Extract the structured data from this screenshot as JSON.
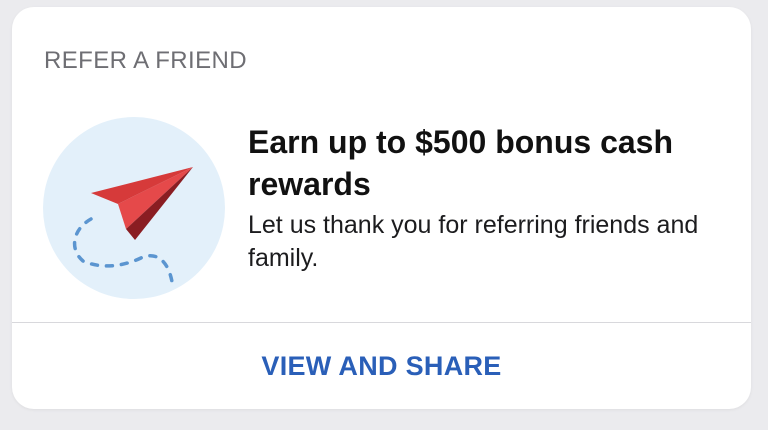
{
  "card": {
    "section_label": "REFER A FRIEND",
    "headline": "Earn up to $500 bonus cash rewards",
    "subtext": "Let us thank you for referring friends and family.",
    "action_label": "VIEW AND SHARE",
    "illustration_icon": "paper-plane-icon"
  },
  "colors": {
    "accent": "#2a5fb8",
    "plane": "#d63a3a",
    "circle_bg": "#e3f0fa",
    "trail": "#5b95d0"
  }
}
